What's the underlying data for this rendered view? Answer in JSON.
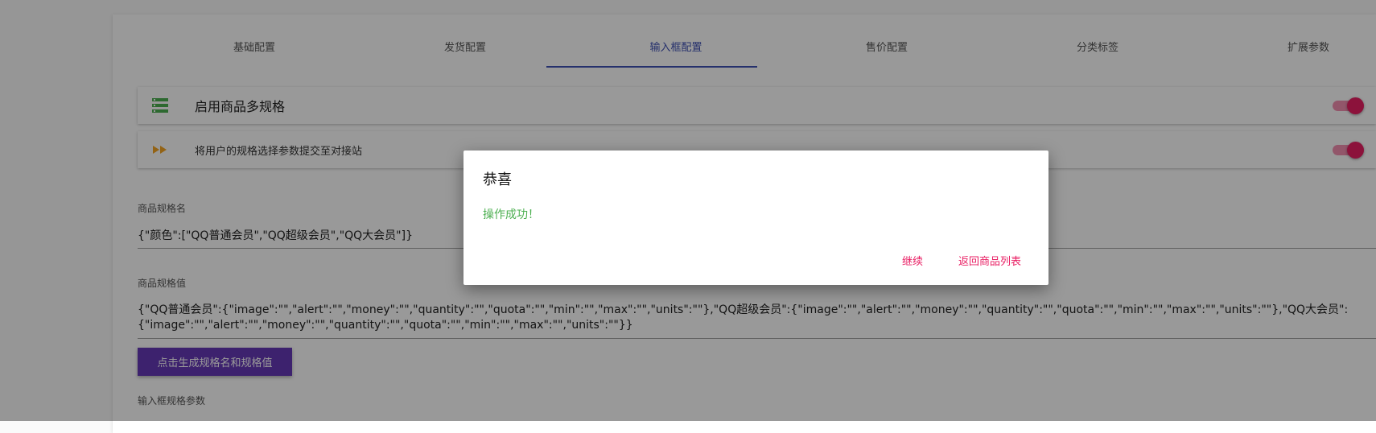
{
  "tabs": [
    {
      "label": "基础配置"
    },
    {
      "label": "发货配置"
    },
    {
      "label": "输入框配置"
    },
    {
      "label": "售价配置"
    },
    {
      "label": "分类标签"
    },
    {
      "label": "扩展参数"
    }
  ],
  "settings": {
    "multi_spec": {
      "label": "启用商品多规格",
      "icon": "list-icon",
      "enabled": true
    },
    "submit_params": {
      "label": "将用户的规格选择参数提交至对接站",
      "icon": "fast-forward-icon",
      "enabled": true
    }
  },
  "spec_name": {
    "label": "商品规格名",
    "value": "{\"颜色\":[\"QQ普通会员\",\"QQ超级会员\",\"QQ大会员\"]}"
  },
  "spec_value": {
    "label": "商品规格值",
    "value": "{\"QQ普通会员\":{\"image\":\"\",\"alert\":\"\",\"money\":\"\",\"quantity\":\"\",\"quota\":\"\",\"min\":\"\",\"max\":\"\",\"units\":\"\"},\"QQ超级会员\":{\"image\":\"\",\"alert\":\"\",\"money\":\"\",\"quantity\":\"\",\"quota\":\"\",\"min\":\"\",\"max\":\"\",\"units\":\"\"},\"QQ大会员\":{\"image\":\"\",\"alert\":\"\",\"money\":\"\",\"quantity\":\"\",\"quota\":\"\",\"min\":\"\",\"max\":\"\",\"units\":\"\"}}"
  },
  "generate_button": "点击生成规格名和规格值",
  "input_spec_label": "输入框规格参数",
  "dialog": {
    "title": "恭喜",
    "message": "操作成功！",
    "continue_label": "继续",
    "return_label": "返回商品列表"
  },
  "colors": {
    "accent": "#3f51b5",
    "toggle": "#e91e63",
    "button": "#673ab7",
    "success": "#4caf50"
  }
}
